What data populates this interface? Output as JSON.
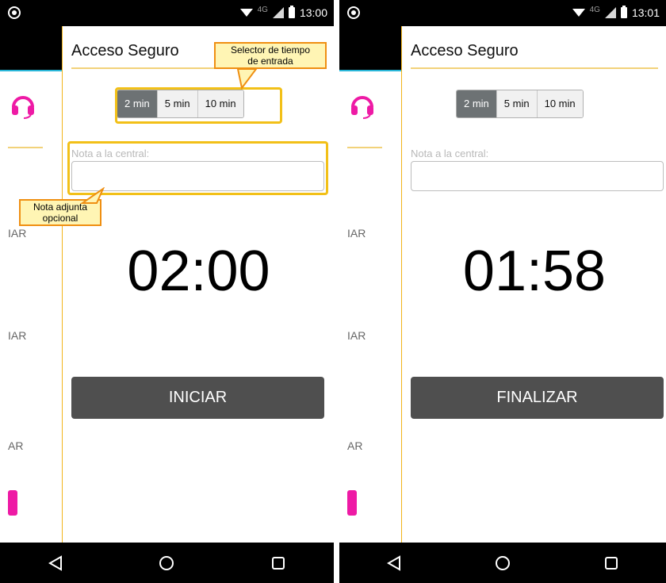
{
  "status_left": {
    "time": "13:00",
    "net": "4G"
  },
  "status_right": {
    "time": "13:01",
    "net": "4G"
  },
  "left_screen": {
    "title": "Acceso Seguro",
    "time_options": [
      "2 min",
      "5 min",
      "10 min"
    ],
    "selected_option": "2 min",
    "note_label": "Nota a la central:",
    "note_value": "",
    "timer": "02:00",
    "button_label": "INICIAR",
    "drawer_labels": [
      "IAR",
      "IAR",
      "AR"
    ]
  },
  "right_screen": {
    "title": "Acceso Seguro",
    "time_options": [
      "2 min",
      "5 min",
      "10 min"
    ],
    "selected_option": "2 min",
    "note_label": "Nota a la central:",
    "note_value": "",
    "timer": "01:58",
    "button_label": "FINALIZAR",
    "drawer_labels": [
      "IAR",
      "IAR",
      "AR"
    ]
  },
  "annotations": {
    "selector_callout_line1": "Selector de tiempo",
    "selector_callout_line2": "de entrada",
    "note_callout_line1": "Nota adjunta",
    "note_callout_line2": "opcional"
  },
  "colors": {
    "accent_yellow": "#f2c018",
    "callout_border": "#ef8f12",
    "headset_pink": "#ee1aa5",
    "button_dark": "#4f4f4f",
    "segment_active": "#6d7274"
  },
  "icons": {
    "status_left": "android-debug-icon",
    "headset": "headset-icon",
    "nav_back": "back-triangle-icon",
    "nav_home": "home-circle-icon",
    "nav_recents": "recents-square-icon"
  }
}
